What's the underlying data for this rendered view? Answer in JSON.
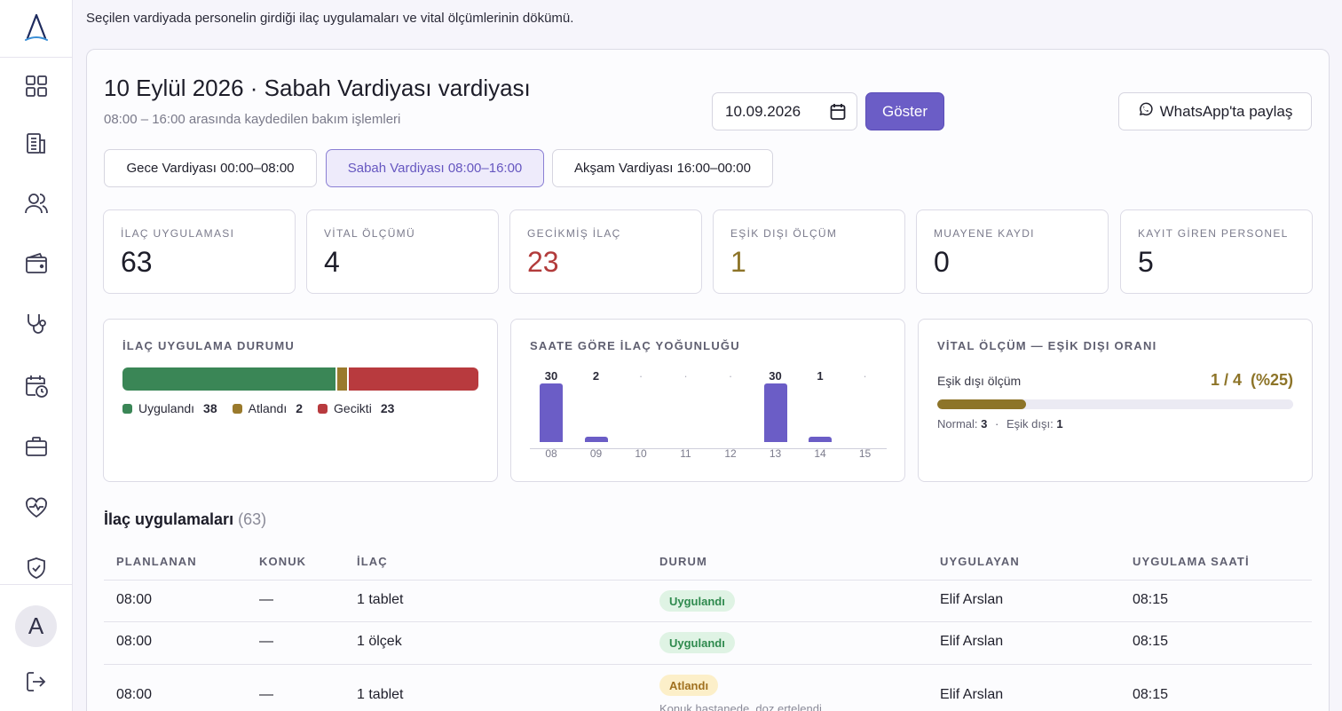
{
  "page_description": "Seçilen vardiyada personelin girdiği ilaç uygulamaları ve vital ölçümlerinin dökümü.",
  "header": {
    "title": "10 Eylül 2026 · Sabah Vardiyası vardiyası",
    "subtitle": "08:00 – 16:00 arasında kaydedilen bakım işlemleri",
    "date_value": "10.09.2026",
    "show_button": "Göster",
    "whatsapp_button": "WhatsApp'ta paylaş"
  },
  "shifts": [
    {
      "label": "Gece Vardiyası 00:00–08:00",
      "active": false
    },
    {
      "label": "Sabah Vardiyası 08:00–16:00",
      "active": true
    },
    {
      "label": "Akşam Vardiyası 16:00–00:00",
      "active": false
    }
  ],
  "stats": [
    {
      "label": "İLAÇ UYGULAMASI",
      "value": "63",
      "color": "#1d1d29"
    },
    {
      "label": "VİTAL ÖLÇÜMÜ",
      "value": "4",
      "color": "#1d1d29"
    },
    {
      "label": "GECİKMİŞ İLAÇ",
      "value": "23",
      "color": "#b23b3b"
    },
    {
      "label": "EŞİK DIŞI ÖLÇÜM",
      "value": "1",
      "color": "#8d7428"
    },
    {
      "label": "MUAYENE KAYDI",
      "value": "0",
      "color": "#1d1d29"
    },
    {
      "label": "KAYIT GİREN PERSONEL",
      "value": "5",
      "color": "#1d1d29"
    }
  ],
  "med_status": {
    "title": "İLAÇ UYGULAMA DURUMU",
    "items": [
      {
        "label": "Uygulandı",
        "value": 38,
        "color": "#3a8656"
      },
      {
        "label": "Atlandı",
        "value": 2,
        "color": "#9a7a2c"
      },
      {
        "label": "Gecikti",
        "value": 23,
        "color": "#b83a3e"
      }
    ]
  },
  "chart_data": {
    "type": "bar",
    "title": "SAATE GÖRE İLAÇ YOĞUNLUĞU",
    "categories": [
      "08",
      "09",
      "10",
      "11",
      "12",
      "13",
      "14",
      "15"
    ],
    "values": [
      30,
      2,
      0,
      0,
      0,
      30,
      1,
      0
    ],
    "value_labels": [
      "30",
      "2",
      "·",
      "·",
      "·",
      "30",
      "1",
      "·"
    ],
    "xlabel": "",
    "ylabel": "",
    "color": "#6b5dc6"
  },
  "vital": {
    "title": "VİTAL ÖLÇÜM — EŞİK DIŞI ORANI",
    "label": "Eşik dışı ölçüm",
    "ratio_text": "1 / 4  (%25)",
    "fraction": 0.25,
    "normal_label": "Normal:",
    "normal_value": "3",
    "separator": "·",
    "out_label": "Eşik dışı:",
    "out_value": "1"
  },
  "table": {
    "title": "İlaç uygulamaları",
    "count": "(63)",
    "columns": [
      "PLANLANAN",
      "KONUK",
      "İLAÇ",
      "DURUM",
      "UYGULAYAN",
      "UYGULAMA SAATİ"
    ],
    "rows": [
      {
        "planned": "08:00",
        "guest": "—",
        "drug": "1 tablet",
        "status": "Uygulandı",
        "status_type": "ok",
        "note": "",
        "by": "Elif Arslan",
        "time": "08:15"
      },
      {
        "planned": "08:00",
        "guest": "—",
        "drug": "1 ölçek",
        "status": "Uygulandı",
        "status_type": "ok",
        "note": "",
        "by": "Elif Arslan",
        "time": "08:15"
      },
      {
        "planned": "08:00",
        "guest": "—",
        "drug": "1 tablet",
        "status": "Atlandı",
        "status_type": "skip",
        "note": "Konuk hastanede, doz ertelendi",
        "by": "Elif Arslan",
        "time": "08:15"
      }
    ]
  },
  "sidebar": {
    "icons": [
      "dashboard-icon",
      "building-icon",
      "users-icon",
      "wallet-icon",
      "stethoscope-icon",
      "calendar-clock-icon",
      "briefcase-icon",
      "heart-pulse-icon",
      "shield-check-icon"
    ],
    "avatar_letter": "A"
  }
}
